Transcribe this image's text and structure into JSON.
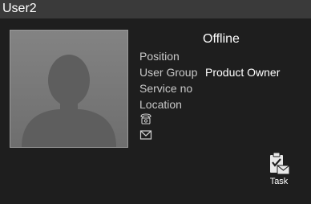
{
  "window": {
    "title": "User2"
  },
  "user": {
    "status": "Offline",
    "fields": [
      {
        "label": "Position",
        "value": ""
      },
      {
        "label": "User Group",
        "value": "Product Owner"
      },
      {
        "label": "Service no",
        "value": ""
      },
      {
        "label": "Location",
        "value": ""
      }
    ]
  },
  "icons": {
    "avatar": "user-silhouette",
    "phone": "phone-icon",
    "email": "envelope-icon",
    "task": "clipboard-task-icon"
  },
  "actions": {
    "task_label": "Task"
  },
  "colors": {
    "background": "#1e1e1e",
    "titlebar": "#3a3a3a",
    "text": "#ffffff",
    "muted_text": "#c8c8c8"
  }
}
